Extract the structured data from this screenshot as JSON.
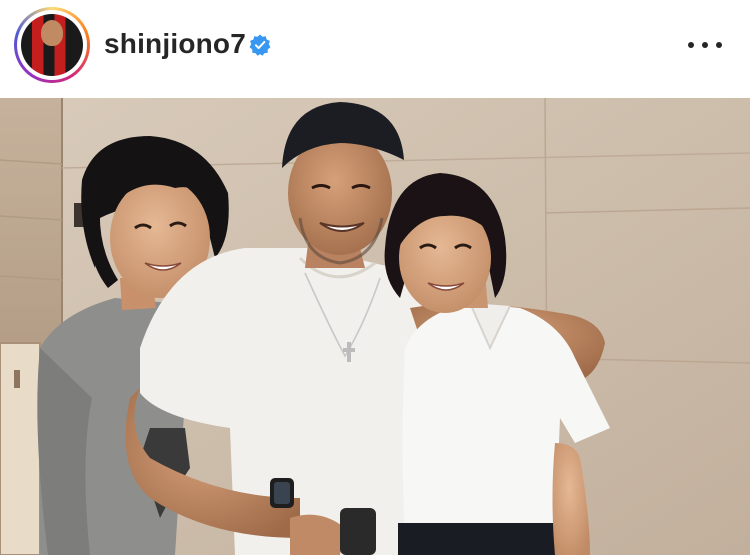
{
  "post_header": {
    "username": "shinjiono7",
    "verified_icon": "verified-badge-icon",
    "more_icon": "more-options-icon",
    "avatar_icon": "profile-avatar"
  },
  "post_image": {
    "kind": "photo"
  },
  "colors": {
    "verified_blue": "#3897f0",
    "text": "#262626"
  }
}
